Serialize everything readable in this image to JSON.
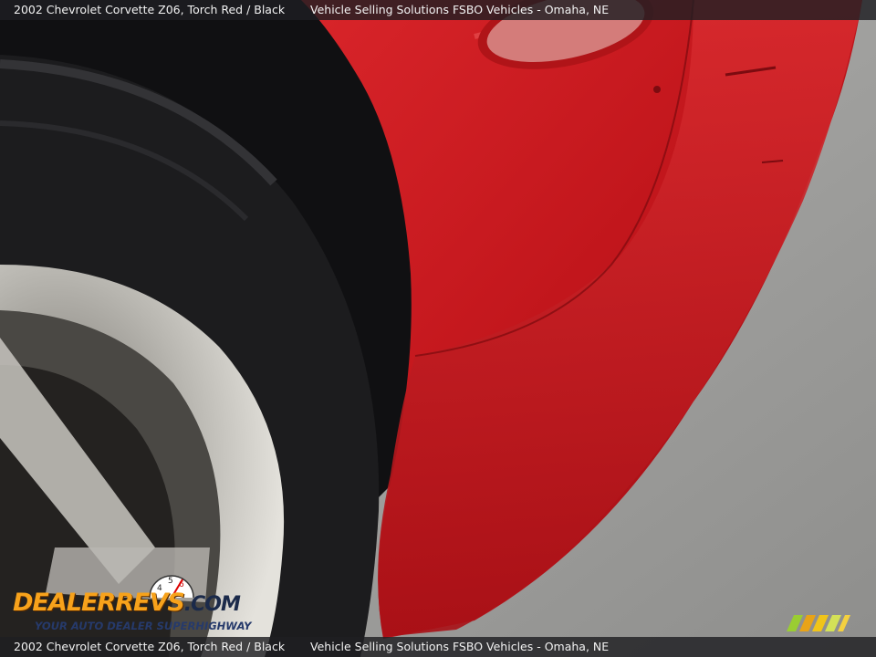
{
  "caption": {
    "vehicle": "2002 Chevrolet Corvette Z06,  Torch Red / Black",
    "seller": "Vehicle Selling Solutions FSBO Vehicles - Omaha, NE"
  },
  "logo": {
    "brand_part1": "DEALER",
    "brand_part2": "REVS",
    "brand_part3": ".COM",
    "tagline": "YOUR AUTO DEALER SUPERHIGHWAY"
  },
  "colors": {
    "car_paint": "#c4161c",
    "tire": "#1c1c1e",
    "pavement": "#9a9a98",
    "caption_bar": "#1e1e22",
    "logo_orange": "#f7a21b"
  },
  "photo_subject": "rear wheel and bumper of red Corvette"
}
